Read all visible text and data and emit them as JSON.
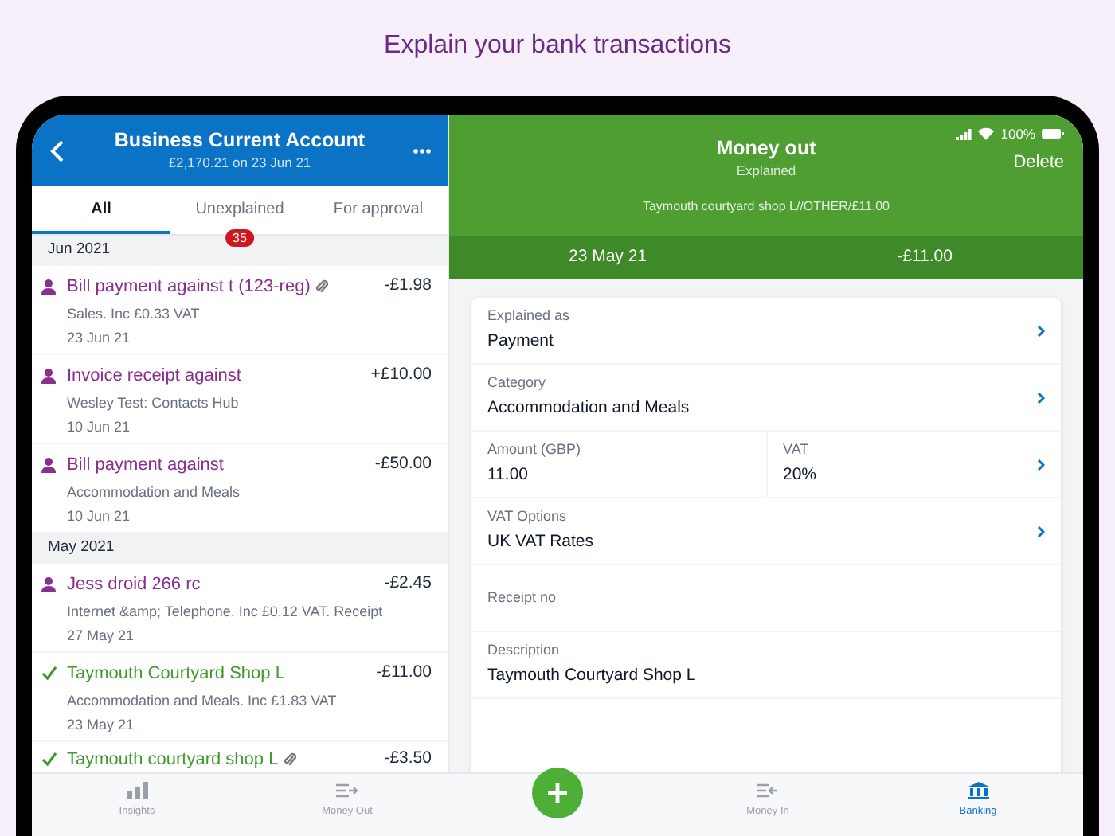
{
  "headline": "Explain your bank transactions",
  "account": {
    "title": "Business Current Account",
    "subtitle": "£2,170.21 on 23 Jun 21"
  },
  "tabs": [
    {
      "label": "All",
      "selected": true
    },
    {
      "label": "Unexplained",
      "selected": false,
      "badge": "35"
    },
    {
      "label": "For approval",
      "selected": false
    }
  ],
  "groups": [
    {
      "label": "Jun 2021",
      "transactions": [
        {
          "kind": "person",
          "title": "Bill payment against t (123-reg)",
          "attachment": true,
          "amount": "-£1.98",
          "detail": "Sales. Inc £0.33 VAT",
          "date": "23 Jun 21"
        },
        {
          "kind": "person",
          "title": "Invoice receipt against",
          "attachment": false,
          "amount": "+£10.00",
          "detail": "Wesley Test: Contacts Hub",
          "date": "10 Jun 21"
        },
        {
          "kind": "person",
          "title": "Bill payment against",
          "attachment": false,
          "amount": "-£50.00",
          "detail": "Accommodation and Meals",
          "date": "10 Jun 21"
        }
      ]
    },
    {
      "label": "May 2021",
      "transactions": [
        {
          "kind": "person",
          "title": "Jess droid 266 rc",
          "attachment": false,
          "amount": "-£2.45",
          "detail": "Internet &amp; Telephone. Inc £0.12 VAT. Receipt",
          "date": "27 May 21"
        },
        {
          "kind": "explained",
          "title": "Taymouth Courtyard Shop L",
          "attachment": false,
          "amount": "-£11.00",
          "detail": "Accommodation and Meals. Inc £1.83 VAT",
          "date": "23 May 21"
        },
        {
          "kind": "explained",
          "title": "Taymouth courtyard shop L",
          "attachment": true,
          "amount": "-£3.50"
        }
      ]
    }
  ],
  "status_bar": {
    "battery": "100%"
  },
  "detail": {
    "title": "Money out",
    "subtitle": "Explained",
    "action": "Delete",
    "reference": "Taymouth courtyard shop L//OTHER/£11.00",
    "date": "23 May 21",
    "amount": "-£11.00",
    "fields": [
      [
        {
          "label": "Explained as",
          "value": "Payment",
          "chevron": true
        }
      ],
      [
        {
          "label": "Category",
          "value": "Accommodation and Meals",
          "chevron": true
        }
      ],
      [
        {
          "label": "Amount (GBP)",
          "value": "11.00",
          "chevron": false
        },
        {
          "label": "VAT",
          "value": "20%",
          "chevron": true
        }
      ],
      [
        {
          "label": "VAT Options",
          "value": "UK VAT Rates",
          "chevron": true
        }
      ],
      [
        {
          "label": "Receipt no",
          "chevron": false
        }
      ],
      [
        {
          "label": "Description",
          "value": "Taymouth Courtyard Shop L",
          "chevron": false
        }
      ]
    ]
  },
  "nav": [
    {
      "kind": "tab",
      "label": "Insights",
      "selected": false
    },
    {
      "kind": "tab",
      "label": "Money Out",
      "selected": false
    },
    {
      "kind": "add"
    },
    {
      "kind": "tab",
      "label": "Money In",
      "selected": false
    },
    {
      "kind": "tab",
      "label": "Banking",
      "selected": true
    }
  ]
}
